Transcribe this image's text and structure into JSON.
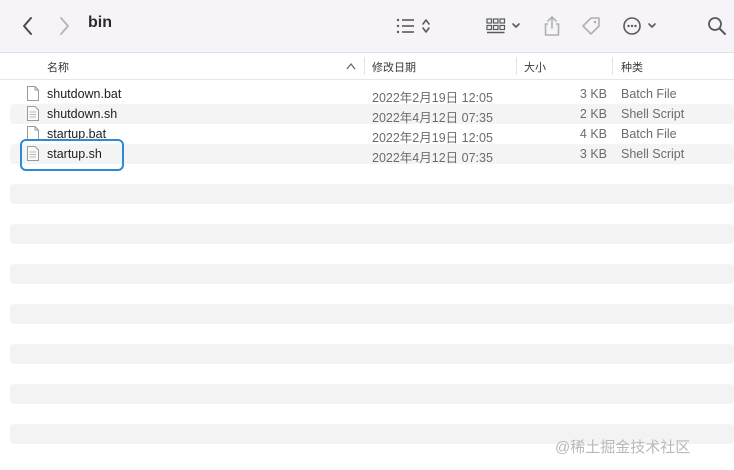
{
  "window": {
    "title": "bin"
  },
  "toolbar": {
    "back_icon": "chevron-left-icon",
    "forward_icon": "chevron-right-icon",
    "list_view_icon": "list-view-icon",
    "grid_view_icon": "grid-view-icon",
    "share_icon": "share-icon",
    "tag_icon": "tag-icon",
    "more_icon": "ellipsis-circle-icon",
    "search_icon": "search-icon"
  },
  "columns": {
    "name": "名称",
    "date": "修改日期",
    "size": "大小",
    "kind": "种类"
  },
  "files": [
    {
      "name": "shutdown.bat",
      "date": "2022年2月19日 12:05",
      "size": "3 KB",
      "kind": "Batch File",
      "icon": "document-icon"
    },
    {
      "name": "shutdown.sh",
      "date": "2022年4月12日 07:35",
      "size": "2 KB",
      "kind": "Shell Script",
      "icon": "script-document-icon"
    },
    {
      "name": "startup.bat",
      "date": "2022年2月19日 12:05",
      "size": "4 KB",
      "kind": "Batch File",
      "icon": "document-icon"
    },
    {
      "name": "startup.sh",
      "date": "2022年4月12日 07:35",
      "size": "3 KB",
      "kind": "Shell Script",
      "icon": "script-document-icon"
    }
  ],
  "watermark": "@稀土掘金技术社区",
  "colors": {
    "focus": "#2f89d6",
    "toolbar_bg": "#f6f4f9",
    "stripe": "#f4f4f5"
  }
}
